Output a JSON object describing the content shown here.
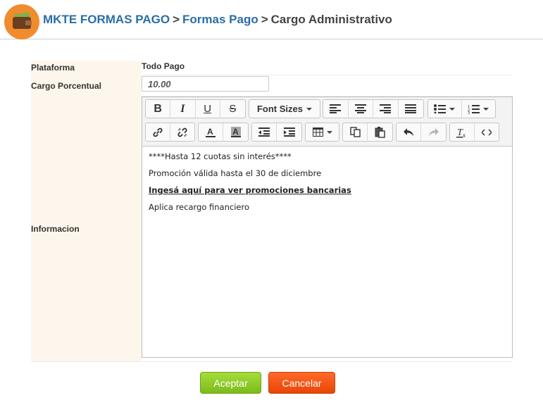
{
  "header": {
    "breadcrumb": [
      "MKTE FORMAS PAGO",
      "Formas Pago",
      "Cargo Administrativo"
    ],
    "separator": ">"
  },
  "form": {
    "plataforma": {
      "label": "Plataforma",
      "value": "Todo Pago"
    },
    "cargo_porcentual": {
      "label": "Cargo Porcentual",
      "value": "10.00"
    },
    "informacion": {
      "label": "Informacion"
    }
  },
  "editor": {
    "font_sizes_label": "Font Sizes",
    "toolbar_icons": [
      "bold-icon",
      "italic-icon",
      "underline-icon",
      "strikethrough-icon",
      "font-sizes-dropdown",
      "align-left-icon",
      "align-center-icon",
      "align-right-icon",
      "align-justify-icon",
      "bullet-list-icon",
      "numbered-list-icon",
      "link-icon",
      "unlink-icon",
      "text-color-icon",
      "background-color-icon",
      "outdent-icon",
      "indent-icon",
      "table-icon",
      "copy-icon",
      "paste-icon",
      "undo-icon",
      "redo-icon",
      "clear-formatting-icon",
      "source-code-icon"
    ],
    "content": [
      "****Hasta 12 cuotas sin interés****",
      "Promoción válida hasta el 30 de diciembre",
      "Ingesá aquí para ver promociones bancarias",
      "Aplica recargo financiero"
    ]
  },
  "buttons": {
    "accept": "Aceptar",
    "cancel": "Cancelar"
  },
  "colors": {
    "accent_orange": "#f08c2e",
    "link_blue": "#2a6ea6",
    "accept_green": "#8ccc24",
    "cancel_red": "#f25512"
  }
}
